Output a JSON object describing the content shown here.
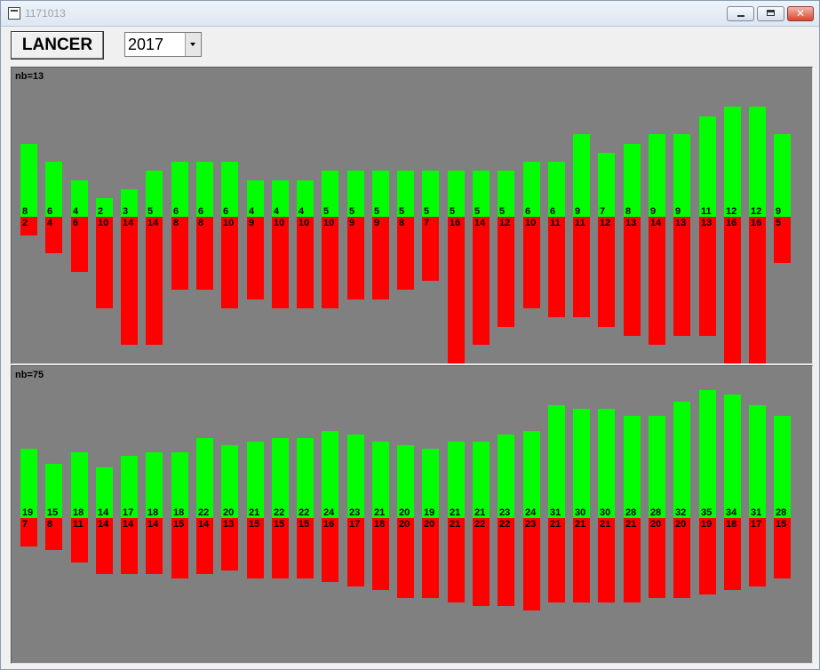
{
  "window": {
    "title": "1171013"
  },
  "toolbar": {
    "launch_label": "LANCER",
    "year_value": "2017"
  },
  "colors": {
    "positive": "#00ff00",
    "negative": "#ff0000",
    "panel_bg": "#808080"
  },
  "chart_data": [
    {
      "type": "bar",
      "label": "nb=13",
      "series": [
        {
          "name": "green",
          "values": [
            8,
            6,
            4,
            2,
            3,
            5,
            6,
            6,
            6,
            4,
            4,
            4,
            5,
            5,
            5,
            5,
            5,
            5,
            5,
            5,
            6,
            6,
            9,
            7,
            8,
            9,
            9,
            11,
            12,
            12,
            9
          ]
        },
        {
          "name": "red",
          "values": [
            2,
            4,
            6,
            10,
            14,
            14,
            8,
            8,
            10,
            9,
            10,
            10,
            10,
            9,
            9,
            8,
            7,
            16,
            14,
            12,
            10,
            11,
            11,
            12,
            13,
            14,
            13,
            13,
            16,
            16,
            5
          ]
        }
      ]
    },
    {
      "type": "bar",
      "label": "nb=75",
      "series": [
        {
          "name": "green",
          "values": [
            19,
            15,
            18,
            14,
            17,
            18,
            18,
            22,
            20,
            21,
            22,
            22,
            24,
            23,
            21,
            20,
            19,
            21,
            21,
            23,
            24,
            31,
            30,
            30,
            28,
            28,
            32,
            35,
            34,
            31,
            28
          ]
        },
        {
          "name": "red",
          "values": [
            7,
            8,
            11,
            14,
            14,
            14,
            15,
            14,
            13,
            15,
            15,
            15,
            16,
            17,
            18,
            20,
            20,
            21,
            22,
            22,
            23,
            21,
            21,
            21,
            21,
            20,
            20,
            19,
            18,
            17,
            15
          ]
        }
      ]
    }
  ]
}
